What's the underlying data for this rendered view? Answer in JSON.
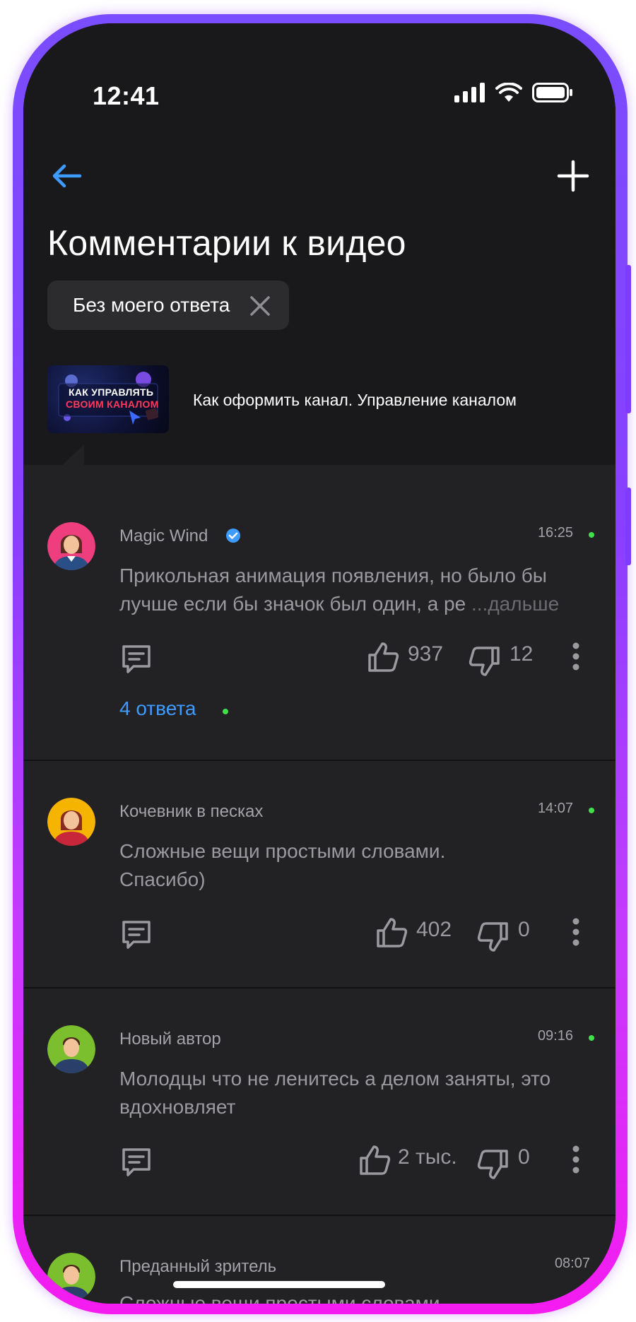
{
  "status_bar": {
    "time": "12:41"
  },
  "header": {
    "title": "Комментарии к видео",
    "filter_chip": "Без моего ответа"
  },
  "video": {
    "thumb_line1": "КАК УПРАВЛЯТЬ",
    "thumb_line2": "СВОИМ КАНАЛОМ",
    "title": "Как оформить канал. Управление каналом"
  },
  "comments": [
    {
      "author": "Magic Wind",
      "verified": true,
      "time": "16:25",
      "online": true,
      "text": "Прикольная анимация появления, но было бы лучше если бы значок был один, а ре",
      "more": "...дальше",
      "likes": "937",
      "dislikes": "12",
      "replies": "4 ответа"
    },
    {
      "author": "Кочевник в песках",
      "time": "14:07",
      "online": true,
      "text": "Сложные вещи простыми словами. Спасибо)",
      "likes": "402",
      "dislikes": "0"
    },
    {
      "author": "Новый автор",
      "time": "09:16",
      "online": true,
      "text": "Молодцы что не ленитесь а делом заняты, это вдохновляет",
      "likes": "2 тыс.",
      "dislikes": "0"
    },
    {
      "author": "Преданный зритель",
      "time": "08:07",
      "text": "Сложные вещи простыми словами."
    }
  ],
  "colors": {
    "accent": "#3e9bff",
    "online": "#3fe04a",
    "background": "#222224"
  },
  "icons": [
    "back-arrow-icon",
    "plus-icon",
    "close-icon",
    "verified-icon",
    "reply-icon",
    "thumb-up-icon",
    "thumb-down-icon",
    "more-vertical-icon"
  ]
}
